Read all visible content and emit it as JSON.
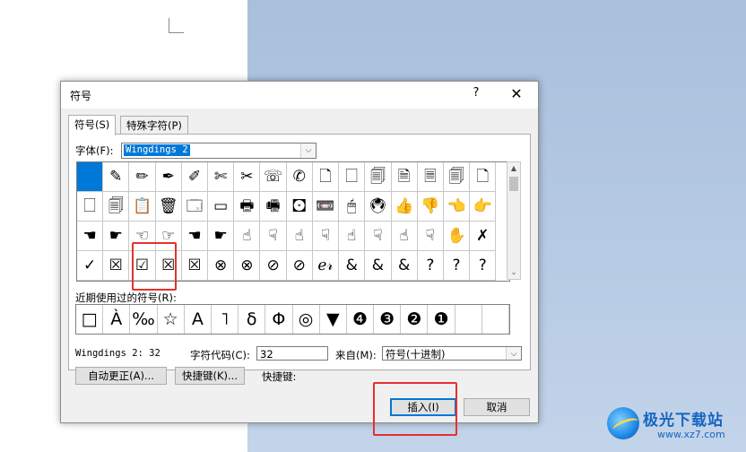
{
  "dialog": {
    "title": "符号",
    "help_label": "?",
    "close_label": "✕"
  },
  "tabs": [
    {
      "label": "符号(S)"
    },
    {
      "label": "特殊字符(P)"
    }
  ],
  "font": {
    "label": "字体(F):",
    "value": "Wingdings 2",
    "arrow": "⌵"
  },
  "symbol_grid": {
    "rows": [
      [
        " ",
        "✎",
        "✏",
        "✒",
        "✐",
        "✄",
        "✂",
        "☏",
        "✆",
        "🗋",
        "🗌",
        "🗐",
        "🗎",
        "🗏",
        "🗐",
        "🗋"
      ],
      [
        "🗌",
        "🗐",
        "📋",
        "🗑",
        "🗔",
        "▭",
        "🖶",
        "🖷",
        "🖸",
        "📼",
        "🖱",
        "🖲",
        "👍",
        "👎",
        "👈",
        "👉"
      ],
      [
        "☚",
        "☛",
        "☜",
        "☞",
        "☚",
        "☛",
        "☝",
        "☟",
        "☝",
        "☟",
        "☝",
        "☟",
        "☝",
        "☟",
        "✋",
        "✗"
      ],
      [
        "✓",
        "☒",
        "☑",
        "☒",
        "☒",
        "⊗",
        "⊗",
        "⊘",
        "⊘",
        "ℯ𝓇",
        "&",
        "&",
        "&",
        "?",
        "?",
        "?"
      ]
    ],
    "selected_index": 0
  },
  "scrollbar": {
    "up": "▲",
    "down": "⌄"
  },
  "recent": {
    "label": "近期使用过的符号(R):",
    "items": [
      "□",
      "À",
      "‰",
      "☆",
      "A",
      "˥",
      "δ",
      "Φ",
      "◎",
      "▼",
      "❹",
      "❸",
      "❷",
      "❶",
      "",
      ""
    ]
  },
  "char_info": {
    "name": "Wingdings 2: 32",
    "code_label": "字符代码(C):",
    "code_value": "32",
    "from_label": "来自(M):",
    "from_value": "符号(十进制)"
  },
  "buttons": {
    "autocorrect": "自动更正(A)...",
    "shortcut_key": "快捷键(K)...",
    "shortcut_label": "快捷键:",
    "insert": "插入(I)",
    "cancel": "取消"
  },
  "watermark": {
    "text": "极光下载站",
    "url": "www.xz7.com"
  },
  "colors": {
    "highlight": "#e5312d",
    "selection": "#0078d7"
  }
}
